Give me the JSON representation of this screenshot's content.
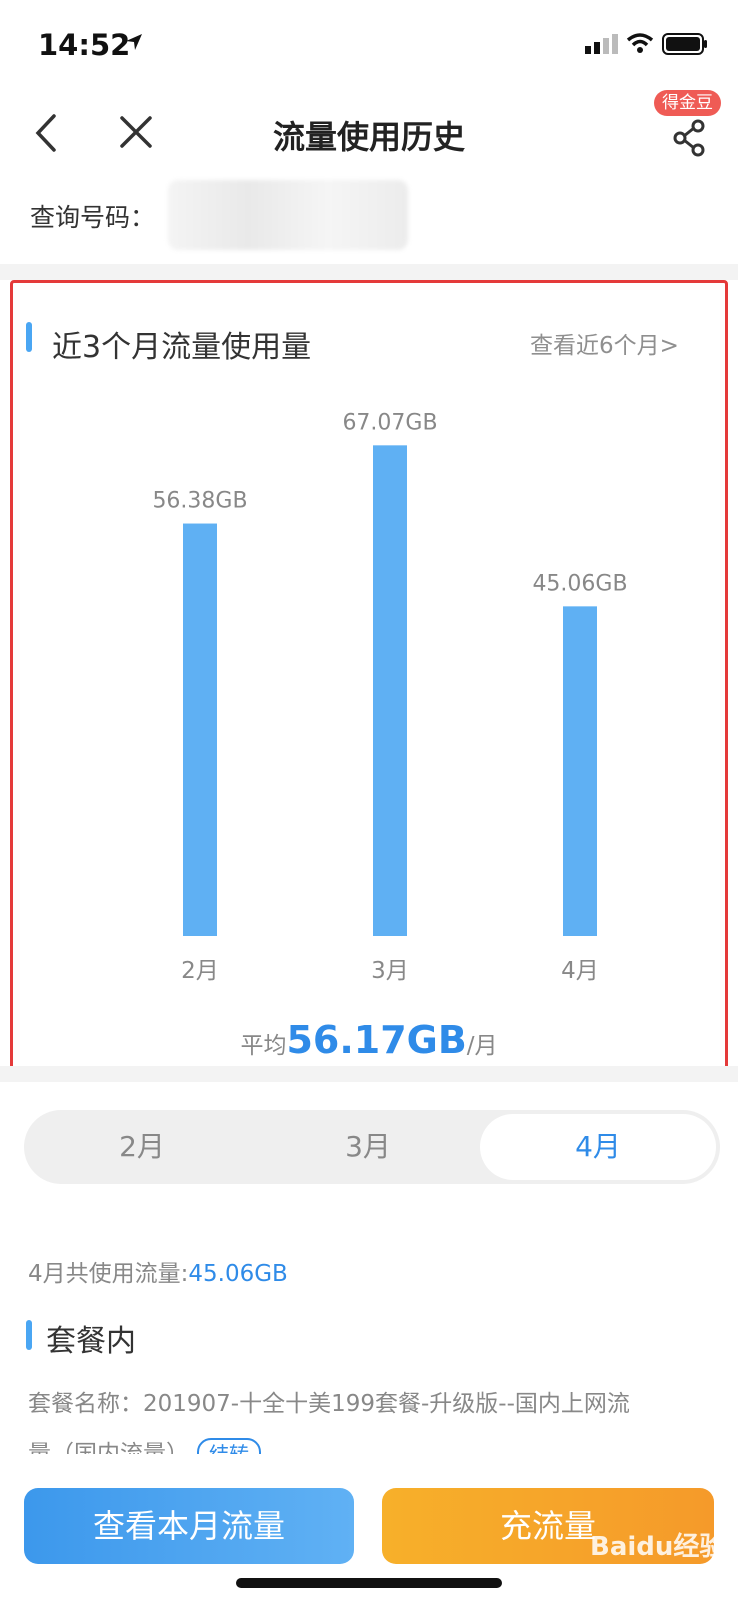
{
  "status_bar": {
    "time": "14:52"
  },
  "nav": {
    "title": "流量使用历史",
    "badge": "得金豆"
  },
  "query": {
    "label": "查询号码："
  },
  "chart_section": {
    "title": "近3个月流量使用量",
    "more_link": "查看近6个月>",
    "avg_prefix": "平均",
    "avg_value": "56.17GB",
    "avg_suffix": "/月"
  },
  "chart_data": {
    "type": "bar",
    "categories": [
      "2月",
      "3月",
      "4月"
    ],
    "values": [
      56.38,
      67.07,
      45.06
    ],
    "value_labels": [
      "56.38GB",
      "67.07GB",
      "45.06GB"
    ],
    "title": "近3个月流量使用量",
    "ylim": [
      0,
      76
    ],
    "bar_color": "#5fb0f3"
  },
  "month_tabs": [
    {
      "label": "2月",
      "active": false
    },
    {
      "label": "3月",
      "active": false
    },
    {
      "label": "4月",
      "active": true
    }
  ],
  "usage_summary": {
    "prefix": "4月共使用流量:",
    "value": "45.06GB"
  },
  "package": {
    "title": "套餐内",
    "desc": "套餐名称：201907-十全十美199套餐-升级版--国内上网流",
    "desc2": "量（国内流量）",
    "tag": "结转"
  },
  "buttons": {
    "left": "查看本月流量",
    "right": "充流量"
  },
  "watermark": "Baidu经验",
  "colors": {
    "accent": "#2f8be8",
    "bar": "#5fb0f3",
    "badge": "#ef5b55",
    "frame": "#e43a3a",
    "btn_orange": "#f7a52a"
  }
}
